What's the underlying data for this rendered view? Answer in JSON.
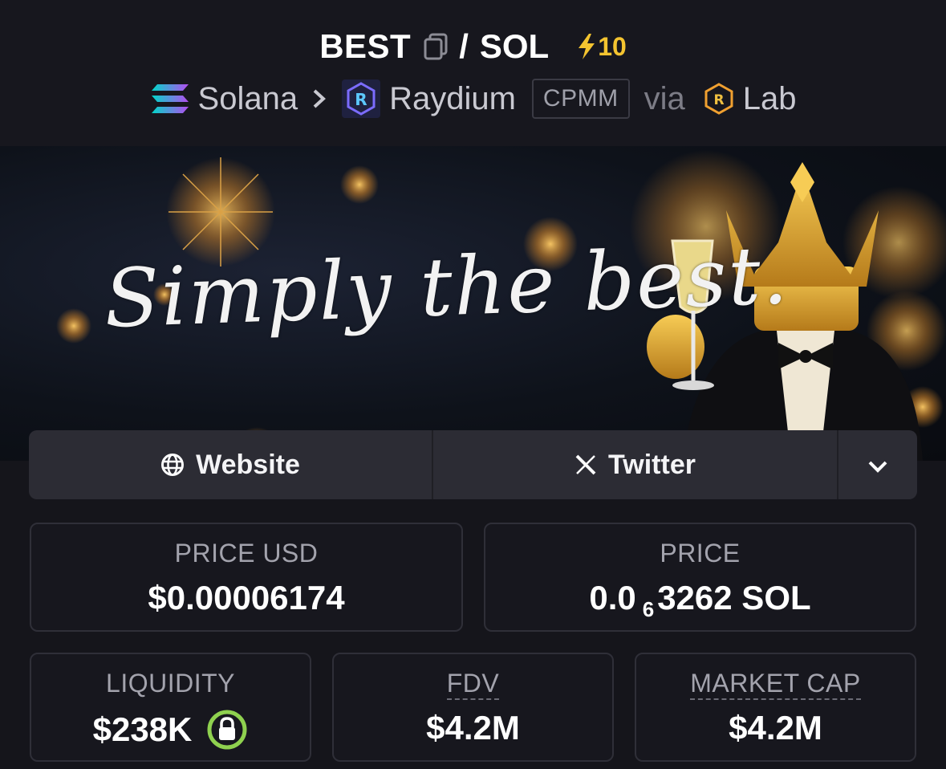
{
  "pair": {
    "base": "BEST",
    "separator": "/",
    "quote": "SOL",
    "boost_count": "10",
    "boost_color": "#f4c430"
  },
  "route": {
    "chain": "Solana",
    "dex": "Raydium",
    "pool_type": "CPMM",
    "via_label": "via",
    "launchpad": "Lab"
  },
  "banner": {
    "slogan": "Simply the best."
  },
  "links": {
    "website": "Website",
    "twitter": "Twitter",
    "more_icon": "chevron-down-icon"
  },
  "stats": {
    "price_usd_label": "PRICE USD",
    "price_usd_value": "$0.00006174",
    "price_label": "PRICE",
    "price_value_prefix": "0.0",
    "price_value_zeros": "6",
    "price_value_digits": "3262 SOL",
    "liquidity_label": "LIQUIDITY",
    "liquidity_value": "$238K",
    "fdv_label": "FDV",
    "fdv_value": "$4.2M",
    "market_cap_label": "MARKET CAP",
    "market_cap_value": "$4.2M"
  },
  "colors": {
    "background": "#15151b",
    "card_border": "#2f2f38",
    "lock_green": "#8fd14f"
  }
}
